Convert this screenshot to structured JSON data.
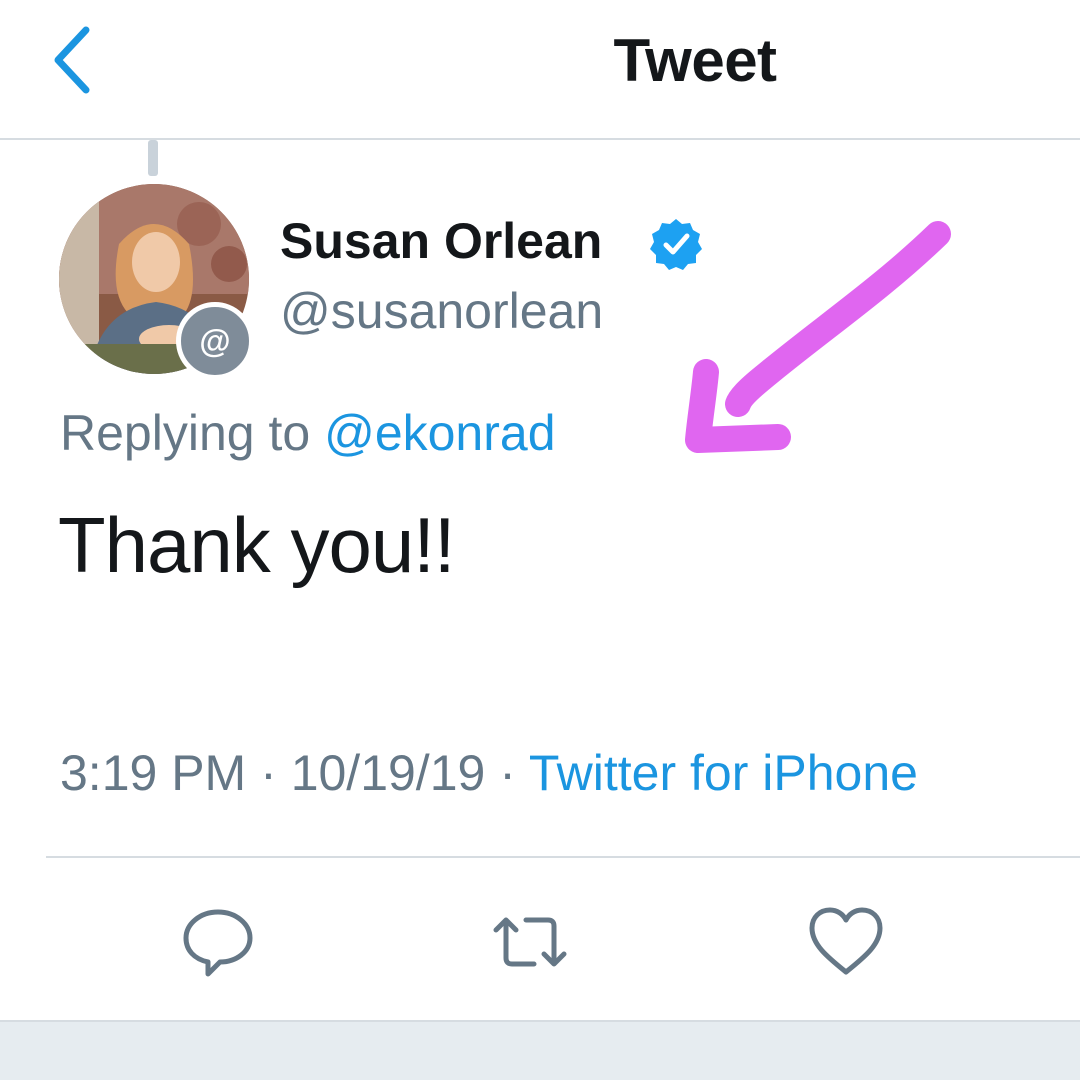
{
  "header": {
    "title": "Tweet",
    "back_icon": "chevron-left-icon"
  },
  "tweet": {
    "display_name": "Susan Orlean",
    "verified": true,
    "handle": "@susanorlean",
    "replying_prefix": "Replying to",
    "replying_to": "@ekonrad",
    "text": "Thank you!!",
    "time": "3:19 PM",
    "date": "10/19/19",
    "separator": "·",
    "source": "Twitter for iPhone",
    "avatar_badge": "@"
  },
  "actions": {
    "reply_icon": "reply-icon",
    "retweet_icon": "retweet-icon",
    "like_icon": "heart-icon"
  },
  "colors": {
    "accent": "#1b95e0",
    "muted_text": "#657786",
    "primary_text": "#14171a",
    "annotation": "#e066f0"
  }
}
